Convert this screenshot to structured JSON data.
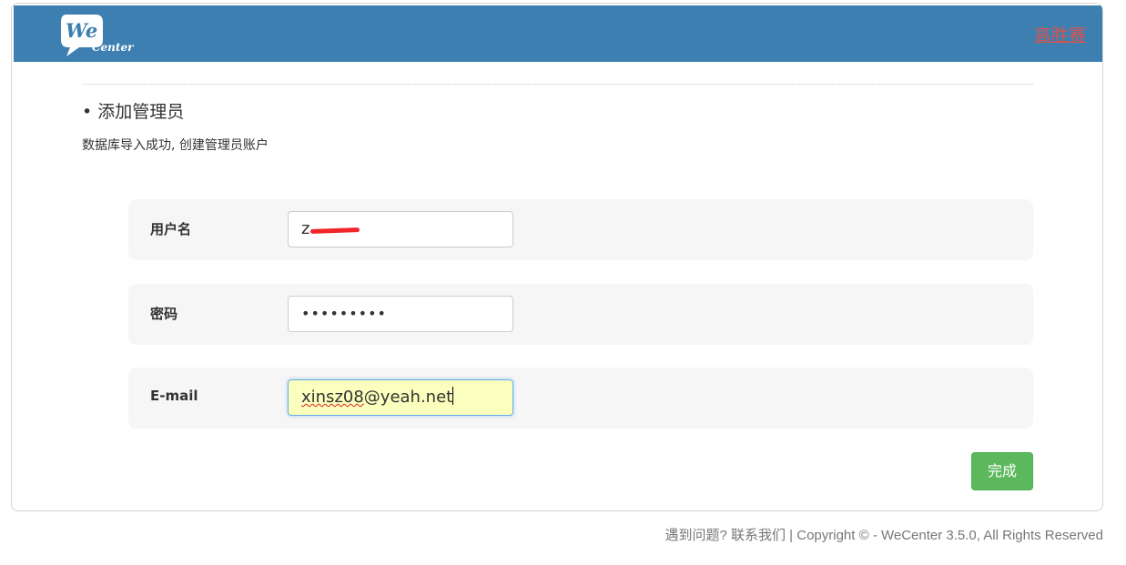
{
  "header": {
    "logo_text_main": "We",
    "logo_text_sub": "Center",
    "status_text": "高胜赛"
  },
  "section": {
    "title": "• 添加管理员",
    "description": "数据库导入成功, 创建管理员账户"
  },
  "form": {
    "username": {
      "label": "用户名",
      "value_visible": "z"
    },
    "password": {
      "label": "密码",
      "value": "•••••••••"
    },
    "email": {
      "label": "E-mail",
      "value_underlined": "xinsz08",
      "value_rest": "@yeah.net"
    },
    "submit_label": "完成"
  },
  "footer": {
    "text": "遇到问题? 联系我们 | Copyright © - WeCenter 3.5.0, All Rights Reserved"
  },
  "colors": {
    "header_bg": "#3d7fb0",
    "submit_bg": "#5cb85c",
    "autofill_bg": "#faffbd",
    "status_red": "#d9534f"
  }
}
